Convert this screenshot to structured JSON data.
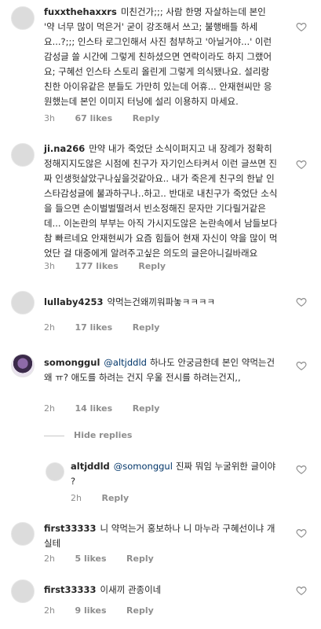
{
  "comments": [
    {
      "username": "fuxxthehaxxrs",
      "text": "미친건가;;; 사람 한명 자살하는데 본인 '약 너무 많이 먹은거' 굳이 강조해서 쓰고; 불행배틀 하세요...?;;; 인스타 로그인해서 사진 첨부하고 '아닐거야...' 이런 감성글 쓸 시간에 그렇게 친하셨으면 연락이라도 하지 그랬어요; 구혜선 인스타 스토리 올린게 그렇게 의식됐나요. 설리랑 친한 아이유같은 분들도 가만히 있는데 어휴... 안재현씨만 응원했는데 본인 이미지 터닝에 설리 이용하지 마세요.",
      "time": "3h",
      "likes": "67 likes",
      "reply": "Reply"
    },
    {
      "username": "ji.na266",
      "text": "만약 내가 죽었단 소식이퍼지고 내 장례가 정확히 정해지지도않은 시점에 친구가 자기인스타켜서 이런 글쓰면 진짜 인생헛살았구나싶을것같아요.. 내가 죽은게 친구의 한낱 인스타감성글에 불과하구나..하고.. 반대로 내친구가 죽었단 소식을 들으면 손이벌벌떨려서 빈소정해진 문자만 기다릴거같은데... 이논란의 부부는 아직 가시지도않은 논란속에서 남들보다 참 빠르네요 안재현씨가 요즘 힘들어 현재 자신이 약을 많이 먹었단 걸 대중에게 알려주고싶은 의도의 글은아니길바래요",
      "time": "3h",
      "likes": "177 likes",
      "reply": "Reply"
    },
    {
      "username": "lullaby4253",
      "text": "약먹는건왜끼워파놓ㅋㅋㅋㅋ",
      "time": "2h",
      "likes": "17 likes",
      "reply": "Reply"
    },
    {
      "username": "somonggul",
      "mention": "@altjddld",
      "text": "하나도 안궁금한데 본인 약먹는건 왜 ㅠ? 애도를 하려는 건지 우울 전시를 하려는건지,,",
      "time": "2h",
      "likes": "14 likes",
      "reply": "Reply"
    },
    {
      "username": "first33333",
      "text": "니 약먹는거 홍보하나 니 마누라 구혜선이냐 개실테",
      "time": "2h",
      "likes": "5 likes",
      "reply": "Reply"
    },
    {
      "username": "first33333",
      "text": "이새끼 관종이네",
      "time": "2h",
      "likes": "9 likes",
      "reply": "Reply"
    }
  ],
  "hide_replies_label": "Hide replies",
  "reply_thread": {
    "username": "altjddld",
    "mention": "@somonggul",
    "text": "진짜 뭐임 누굴위한 글이야 ?",
    "time": "2h",
    "likes": "",
    "reply": "Reply"
  }
}
